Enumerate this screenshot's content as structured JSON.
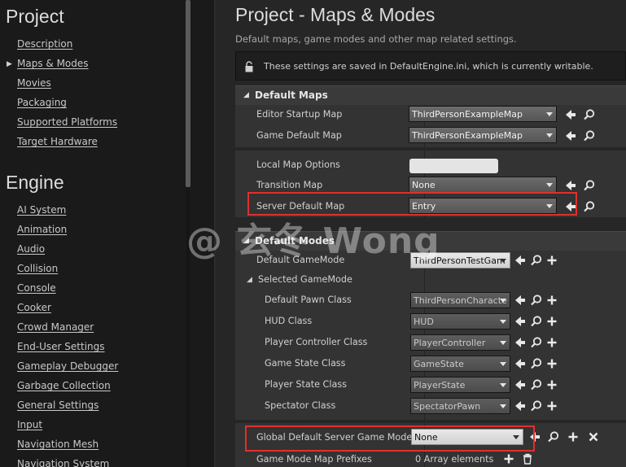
{
  "sidebar": {
    "project_title": "Project",
    "project_items": [
      "Description",
      "Maps & Modes",
      "Movies",
      "Packaging",
      "Supported Platforms",
      "Target Hardware"
    ],
    "selected_item": "Maps & Modes",
    "engine_title": "Engine",
    "engine_items": [
      "AI System",
      "Animation",
      "Audio",
      "Collision",
      "Console",
      "Cooker",
      "Crowd Manager",
      "End-User Settings",
      "Gameplay Debugger",
      "Garbage Collection",
      "General Settings",
      "Input",
      "Navigation Mesh",
      "Navigation System"
    ]
  },
  "main": {
    "title": "Project - Maps & Modes",
    "description": "Default maps, game modes and other map related settings.",
    "notice": "These settings are saved in DefaultEngine.ini, which is currently writable."
  },
  "default_maps": {
    "header": "Default Maps",
    "editor_startup_map": {
      "label": "Editor Startup Map",
      "value": "ThirdPersonExampleMap"
    },
    "game_default_map": {
      "label": "Game Default Map",
      "value": "ThirdPersonExampleMap"
    },
    "local_map_options": {
      "label": "Local Map Options",
      "value": ""
    },
    "transition_map": {
      "label": "Transition Map",
      "value": "None"
    },
    "server_default_map": {
      "label": "Server Default Map",
      "value": "Entry"
    }
  },
  "default_modes": {
    "header": "Default Modes",
    "default_gamemode": {
      "label": "Default GameMode",
      "value": "ThirdPersonTestGam"
    },
    "selected_gamemode": "Selected GameMode",
    "default_pawn_class": {
      "label": "Default Pawn Class",
      "value": "ThirdPersonCharacte"
    },
    "hud_class": {
      "label": "HUD Class",
      "value": "HUD"
    },
    "player_controller_class": {
      "label": "Player Controller Class",
      "value": "PlayerController"
    },
    "game_state_class": {
      "label": "Game State Class",
      "value": "GameState"
    },
    "player_state_class": {
      "label": "Player State Class",
      "value": "PlayerState"
    },
    "spectator_class": {
      "label": "Spectator Class",
      "value": "SpectatorPawn"
    },
    "global_default_server_game_mode": {
      "label": "Global Default Server Game Mode",
      "value": "None"
    },
    "game_mode_map_prefixes": {
      "label": "Game Mode Map Prefixes",
      "value": "0 Array elements"
    }
  },
  "watermark": "@ 玄冬 Wong",
  "colors": {
    "highlight": "#e0302e",
    "panel": "#333333",
    "header": "#3a3a3a",
    "background": "#1a1a1a"
  }
}
